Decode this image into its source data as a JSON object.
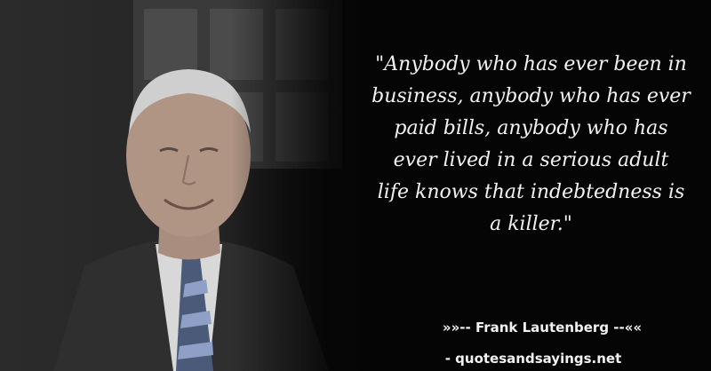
{
  "quote": {
    "lines": [
      "\"Anybody who has ever been in",
      "business, anybody who has ever",
      "paid bills, anybody who has",
      "ever lived in a serious adult",
      "life knows that indebtedness is",
      "a killer.\""
    ]
  },
  "attribution": {
    "author_line": "»»-- Frank Lautenberg --««",
    "site": "- quotesandsayings.net"
  },
  "photo": {
    "subject": "portrait-photo"
  }
}
